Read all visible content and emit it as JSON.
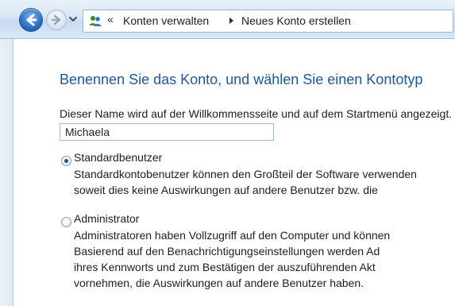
{
  "nav": {
    "back_icon": "back-arrow-icon",
    "forward_icon": "forward-arrow-icon",
    "history_icon": "chevron-down-icon"
  },
  "breadcrumb": {
    "overflow": "«",
    "items": [
      "Konten verwalten",
      "Neues Konto erstellen"
    ],
    "separator_icon": "chevron-right-icon",
    "location_icon": "users-icon"
  },
  "main": {
    "title": "Benennen Sie das Konto, und wählen Sie einen Kontotyp",
    "description": "Dieser Name wird auf der Willkommensseite und auf dem Startmenü angezeigt.",
    "name_field": {
      "value": "Michaela"
    },
    "options": [
      {
        "label": "Standardbenutzer",
        "selected": true,
        "lines": [
          "Standardkontobenutzer können den Großteil der Software verwenden",
          "soweit dies keine Auswirkungen auf andere Benutzer bzw. die"
        ]
      },
      {
        "label": "Administrator",
        "selected": false,
        "lines": [
          "Administratoren haben Vollzugriff auf den Computer und können",
          "Basierend auf den Benachrichtigungseinstellungen werden Ad",
          "ihres Kennworts und zum Bestätigen der auszuführenden Akt",
          "vornehmen, die Auswirkungen auf andere Benutzer haben."
        ]
      }
    ]
  },
  "colors": {
    "heading": "#1b58a6",
    "text": "#1e1e1e",
    "bar_top": "#e9f2fb",
    "bar_bottom": "#c7dbf1",
    "border": "#9fb6d1"
  }
}
